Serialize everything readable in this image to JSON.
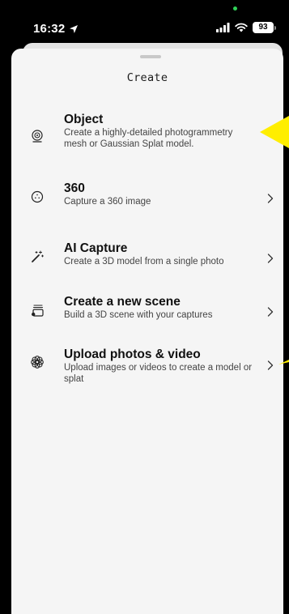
{
  "status_bar": {
    "time": "16:32",
    "battery": "93",
    "icons": [
      "location-arrow-icon",
      "signal-icon",
      "wifi-icon",
      "battery-icon"
    ]
  },
  "sheet": {
    "title": "Create"
  },
  "menu": {
    "items": [
      {
        "icon": "object-capture-icon",
        "title": "Object",
        "description": "Create a highly-detailed photogrammetry mesh or Gaussian Splat model."
      },
      {
        "icon": "360-icon",
        "title": "360",
        "description": "Capture a 360 image"
      },
      {
        "icon": "magic-wand-icon",
        "title": "AI Capture",
        "description": "Create a 3D model from a single photo"
      },
      {
        "icon": "scene-icon",
        "title": "Create a new scene",
        "description": "Build a 3D scene with your captures"
      },
      {
        "icon": "upload-flower-icon",
        "title": "Upload photos & video",
        "description": "Upload images or videos to create a model or splat"
      }
    ]
  },
  "colors": {
    "sheet_background": "#f5f5f5",
    "annotation": "#ffee00",
    "text_primary": "#111111",
    "text_secondary": "#444444"
  }
}
